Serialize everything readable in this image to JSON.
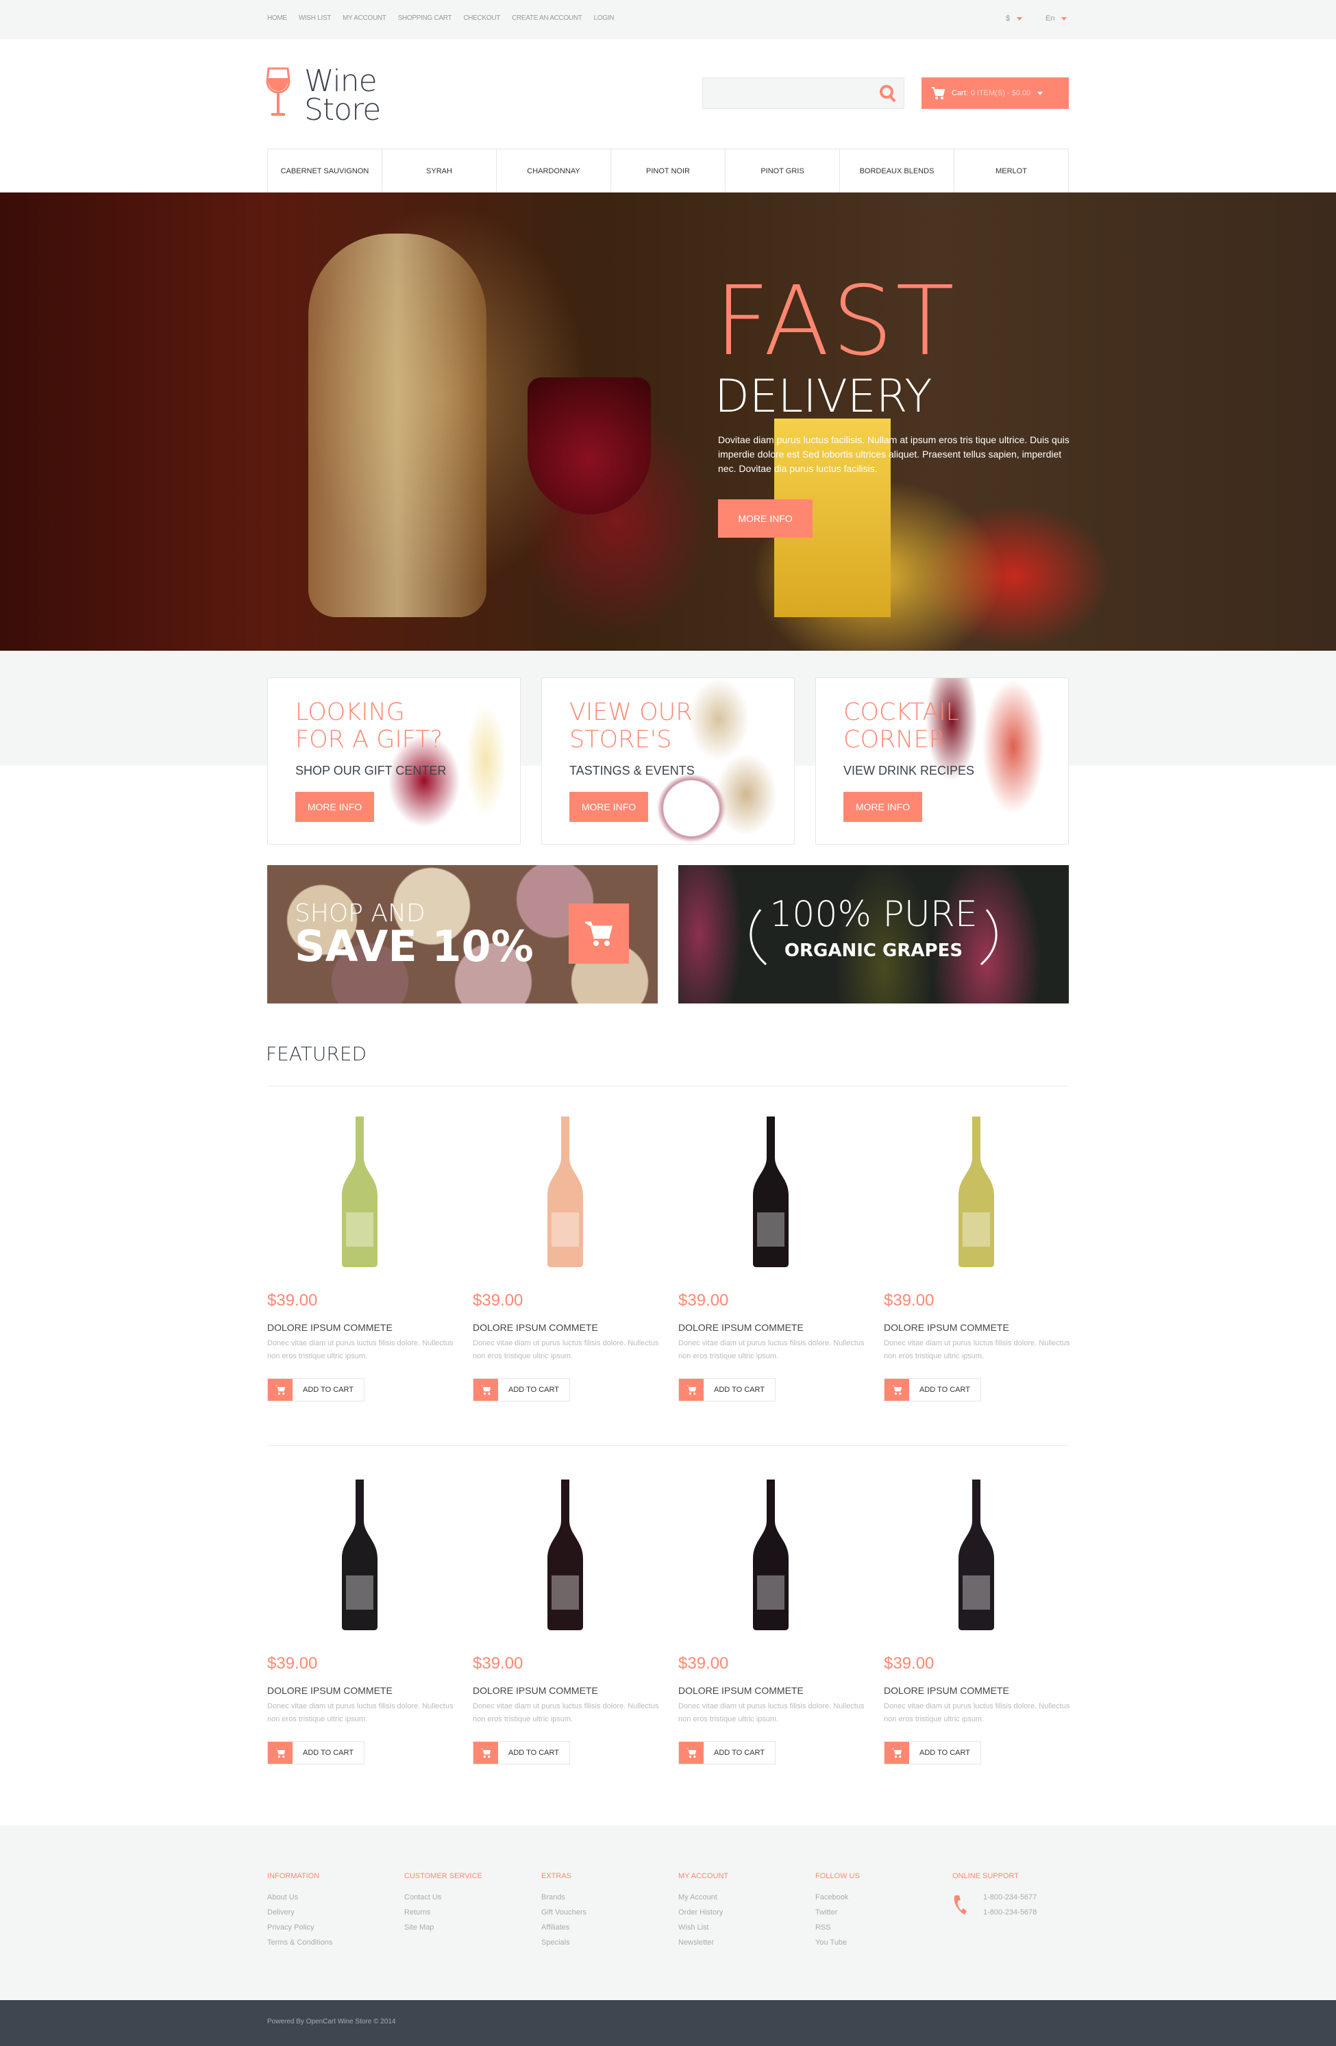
{
  "topbar": {
    "links": [
      "HOME",
      "WISH LIST",
      "MY ACCOUNT",
      "SHOPPING CART",
      "CHECKOUT",
      "CREATE AN ACCOUNT",
      "LOGIN"
    ],
    "currency": "$",
    "language": "En"
  },
  "header": {
    "logo_line1": "Wine",
    "logo_line2": "Store",
    "search_placeholder": "",
    "cart_label": "Cart:",
    "cart_total": "0 ITEM(S) - $0.00"
  },
  "nav": [
    "CABERNET SAUVIGNON",
    "SYRAH",
    "CHARDONNAY",
    "PINOT NOIR",
    "PINOT GRIS",
    "BORDEAUX BLENDS",
    "MERLOT"
  ],
  "hero": {
    "title1": "FAST",
    "title2": "DELIVERY",
    "text": "Dovitae diam purus luctus facilisis. Nullam at ipsum eros tris tique ultrice. Duis quis imperdie dolore est Sed lobortis ultrices aliquet. Praesent tellus sapien, imperdiet nec. Dovitae dia purus luctus facilisis.",
    "button": "MORE INFO"
  },
  "promos": [
    {
      "title1": "LOOKING",
      "title2": "FOR A GIFT?",
      "subtitle": "SHOP OUR GIFT CENTER",
      "button": "MORE INFO"
    },
    {
      "title1": "VIEW OUR",
      "title2": "STORE'S",
      "subtitle": "TASTINGS & EVENTS",
      "button": "MORE INFO"
    },
    {
      "title1": "COCKTAIL",
      "title2": "CORNER",
      "subtitle": "VIEW DRINK RECIPES",
      "button": "MORE INFO"
    }
  ],
  "banners": {
    "save_line1": "SHOP AND",
    "save_line2": "SAVE 10%",
    "organic_line1": "100% PURE",
    "organic_line2": "ORGANIC GRAPES"
  },
  "featured": {
    "title": "FEATURED",
    "products": [
      {
        "price": "$39.00",
        "name": "DOLORE IPSUM COMMETE",
        "desc": "Donec vitae diam ut purus luctus filisis dolore. Nullectus non eros tristique ultric ipsum.",
        "button": "ADD TO CART",
        "bottle": "#b8c870"
      },
      {
        "price": "$39.00",
        "name": "DOLORE IPSUM COMMETE",
        "desc": "Donec vitae diam ut purus luctus filisis dolore. Nullectus non eros tristique ultric ipsum.",
        "button": "ADD TO CART",
        "bottle": "#f2b89a"
      },
      {
        "price": "$39.00",
        "name": "DOLORE IPSUM COMMETE",
        "desc": "Donec vitae diam ut purus luctus filisis dolore. Nullectus non eros tristique ultric ipsum.",
        "button": "ADD TO CART",
        "bottle": "#1a1416"
      },
      {
        "price": "$39.00",
        "name": "DOLORE IPSUM COMMETE",
        "desc": "Donec vitae diam ut purus luctus filisis dolore. Nullectus non eros tristique ultric ipsum.",
        "button": "ADD TO CART",
        "bottle": "#c8c060"
      },
      {
        "price": "$39.00",
        "name": "DOLORE IPSUM COMMETE",
        "desc": "Donec vitae diam ut purus luctus filisis dolore. Nullectus non eros tristique ultric ipsum.",
        "button": "ADD TO CART",
        "bottle": "#1c1a1c"
      },
      {
        "price": "$39.00",
        "name": "DOLORE IPSUM COMMETE",
        "desc": "Donec vitae diam ut purus luctus filisis dolore. Nullectus non eros tristique ultric ipsum.",
        "button": "ADD TO CART",
        "bottle": "#241418"
      },
      {
        "price": "$39.00",
        "name": "DOLORE IPSUM COMMETE",
        "desc": "Donec vitae diam ut purus luctus filisis dolore. Nullectus non eros tristique ultric ipsum.",
        "button": "ADD TO CART",
        "bottle": "#1a1216"
      },
      {
        "price": "$39.00",
        "name": "DOLORE IPSUM COMMETE",
        "desc": "Donec vitae diam ut purus luctus filisis dolore. Nullectus non eros tristique ultric ipsum.",
        "button": "ADD TO CART",
        "bottle": "#201a20"
      }
    ]
  },
  "footer": {
    "columns": [
      {
        "heading": "INFORMATION",
        "links": [
          "About Us",
          "Delivery",
          "Privacy Policy",
          "Terms & Conditions"
        ]
      },
      {
        "heading": "CUSTOMER SERVICE",
        "links": [
          "Contact Us",
          "Returns",
          "Site Map"
        ]
      },
      {
        "heading": "EXTRAS",
        "links": [
          "Brands",
          "Gift Vouchers",
          "Affiliates",
          "Specials"
        ]
      },
      {
        "heading": "MY ACCOUNT",
        "links": [
          "My Account",
          "Order History",
          "Wish List",
          "Newsletter"
        ]
      },
      {
        "heading": "FOLLOW US",
        "links": [
          "Facebook",
          "Twitter",
          "RSS",
          "You Tube"
        ]
      }
    ],
    "support": {
      "heading": "ONLINE SUPPORT",
      "phones": [
        "1-800-234-5677",
        "1-800-234-5678"
      ]
    },
    "copyright": "Powered By OpenCart Wine Store © 2014"
  },
  "colors": {
    "accent": "#ff8772",
    "dark": "#3f4650",
    "light_bg": "#f4f6f5"
  }
}
